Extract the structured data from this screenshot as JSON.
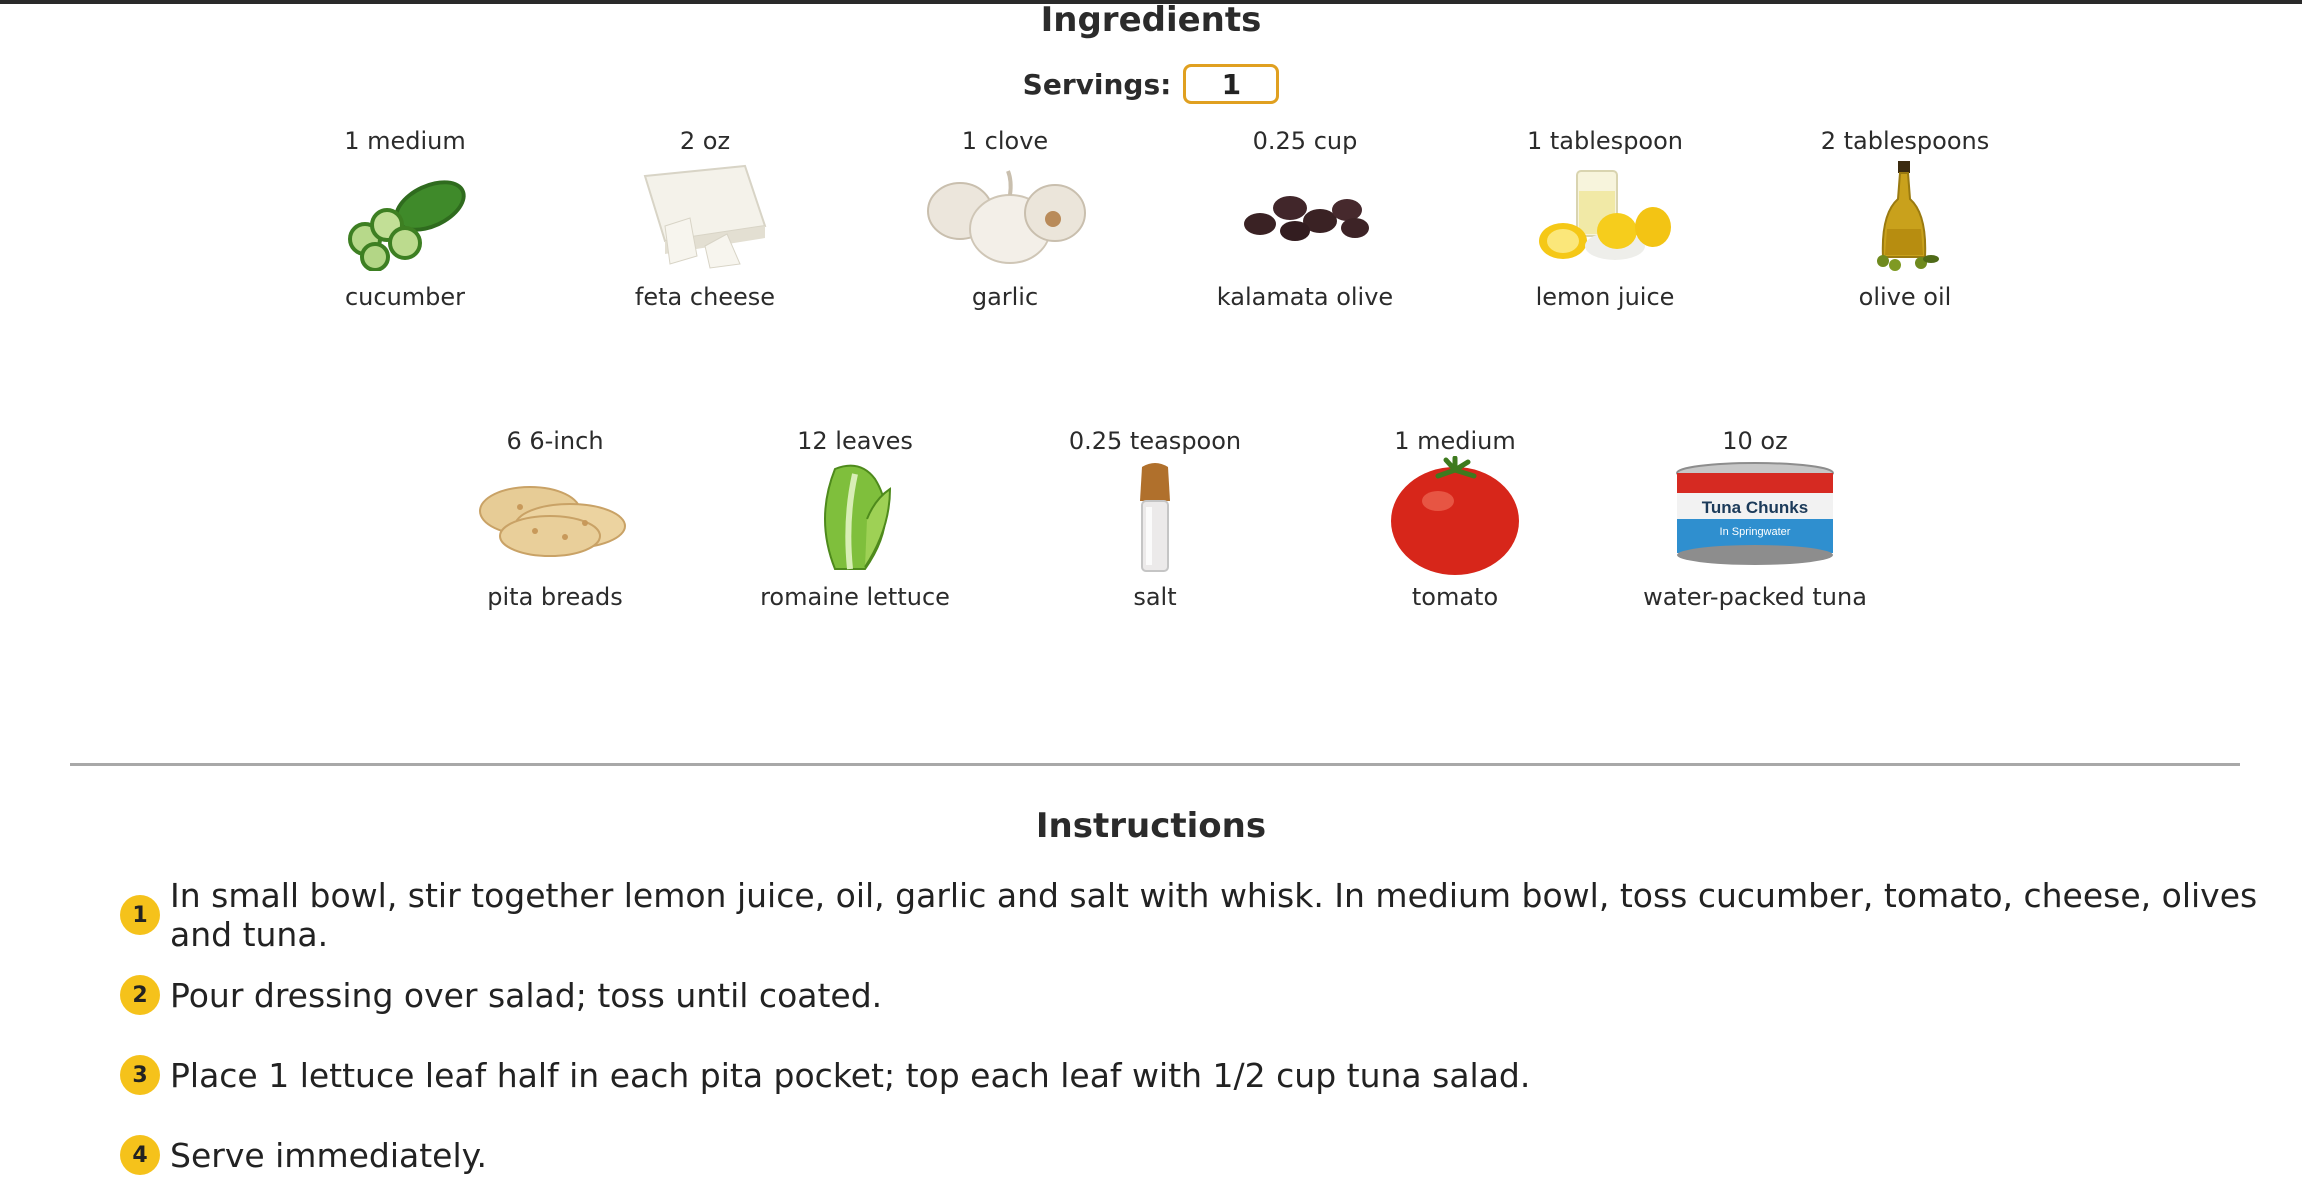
{
  "ingredients_section": {
    "title": "Ingredients",
    "servings_label": "Servings:",
    "servings_value": "1",
    "items": [
      {
        "amount": "1 medium",
        "name": "cucumber",
        "icon": "cucumber-image"
      },
      {
        "amount": "2 oz",
        "name": "feta cheese",
        "icon": "feta-cheese-image"
      },
      {
        "amount": "1 clove",
        "name": "garlic",
        "icon": "garlic-image"
      },
      {
        "amount": "0.25 cup",
        "name": "kalamata olive",
        "icon": "kalamata-olive-image"
      },
      {
        "amount": "1 tablespoon",
        "name": "lemon juice",
        "icon": "lemon-juice-image"
      },
      {
        "amount": "2 tablespoons",
        "name": "olive oil",
        "icon": "olive-oil-image"
      },
      {
        "amount": "6 6-inch",
        "name": "pita breads",
        "icon": "pita-bread-image"
      },
      {
        "amount": "12 leaves",
        "name": "romaine lettuce",
        "icon": "romaine-lettuce-image"
      },
      {
        "amount": "0.25 teaspoon",
        "name": "salt",
        "icon": "salt-shaker-image"
      },
      {
        "amount": "1 medium",
        "name": "tomato",
        "icon": "tomato-image"
      },
      {
        "amount": "10 oz",
        "name": "water-packed tuna",
        "icon": "tuna-can-image"
      }
    ],
    "tuna_label": {
      "line1": "Tuna Chunks",
      "line2": "In Springwater"
    }
  },
  "instructions_section": {
    "title": "Instructions",
    "steps": [
      {
        "num": "1",
        "text": "In small bowl, stir together lemon juice, oil, garlic and salt with whisk. In medium bowl, toss cucumber, tomato, cheese, olives and tuna."
      },
      {
        "num": "2",
        "text": "Pour dressing over salad; toss until coated."
      },
      {
        "num": "3",
        "text": "Place 1 lettuce leaf half in each pita pocket; top each leaf with 1/2 cup tuna salad."
      },
      {
        "num": "4",
        "text": "Serve immediately."
      }
    ]
  },
  "colors": {
    "accent": "#f5c21b",
    "input_border": "#e0a020",
    "divider": "#a8a8a8"
  }
}
